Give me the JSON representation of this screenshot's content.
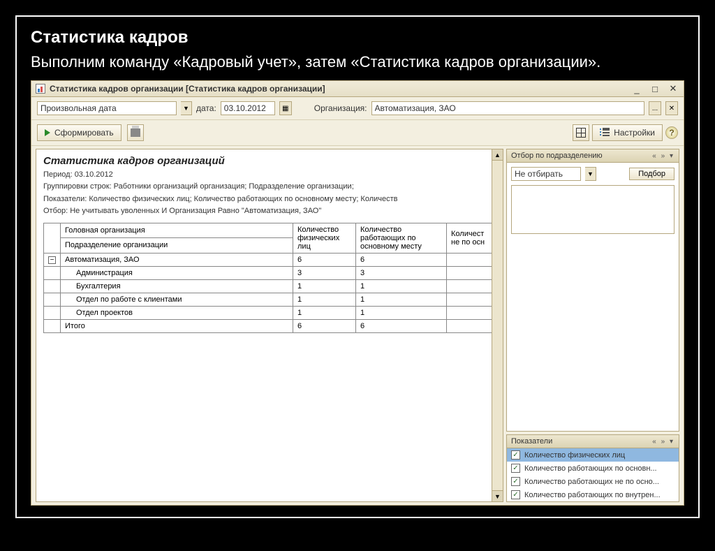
{
  "slide": {
    "title": "Статистика кадров",
    "subtitle": "Выполним команду «Кадровый учет», затем «Статистика кадров организации»."
  },
  "window": {
    "title": "Статистика кадров организации [Статистика кадров организации]"
  },
  "filters": {
    "period_type": "Произвольная дата",
    "date_label": "дата:",
    "date_value": "03.10.2012",
    "org_label": "Организация:",
    "org_value": "Автоматизация, ЗАО"
  },
  "toolbar": {
    "generate": "Сформировать",
    "settings": "Настройки"
  },
  "report": {
    "title": "Статистика кадров организаций",
    "period": "Период: 03.10.2012",
    "groupings": "Группировки строк: Работники организаций организация; Подразделение организации;",
    "indicators": "Показатели: Количество физических лиц; Количество работающих по основному месту; Количеств",
    "filter": "Отбор: Не учитывать уволенных И Организация Равно \"Автоматизация, ЗАО\"",
    "headers": {
      "main_org": "Головная организация",
      "subdivision": "Подразделение организации",
      "col1": "Количество физических лиц",
      "col2": "Количество работающих по основному месту",
      "col3": "Количест не по осн"
    },
    "rows": [
      {
        "name": "Автоматизация, ЗАО",
        "c1": "6",
        "c2": "6",
        "level": 0
      },
      {
        "name": "Администрация",
        "c1": "3",
        "c2": "3",
        "level": 1
      },
      {
        "name": "Бухгалтерия",
        "c1": "1",
        "c2": "1",
        "level": 1
      },
      {
        "name": "Отдел по работе с клиентами",
        "c1": "1",
        "c2": "1",
        "level": 1
      },
      {
        "name": "Отдел проектов",
        "c1": "1",
        "c2": "1",
        "level": 1
      }
    ],
    "total_label": "Итого",
    "total_c1": "6",
    "total_c2": "6"
  },
  "side": {
    "filter_title": "Отбор по подразделению",
    "filter_mode": "Не отбирать",
    "select_btn": "Подбор",
    "indicators_title": "Показатели",
    "indicators": [
      "Количество физических лиц",
      "Количество работающих по основн...",
      "Количество работающих не по осно...",
      "Количество работающих по внутрен..."
    ]
  }
}
